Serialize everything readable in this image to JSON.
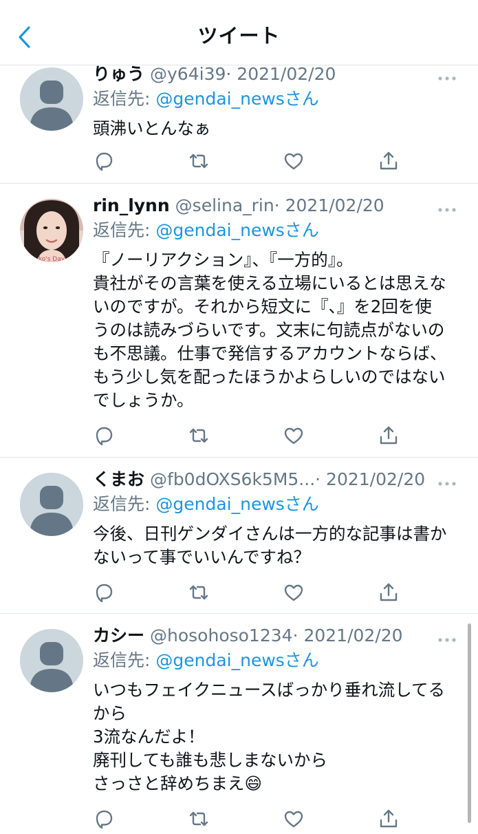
{
  "header": {
    "title": "ツイート"
  },
  "tweets": [
    {
      "name": "りゅう",
      "handle": "@y64i39",
      "date": "· 2021/02/20",
      "reply_prefix": "返信先: ",
      "reply_to": "@gendai_newsさん",
      "lines": [
        "頭沸いとんなぁ"
      ]
    },
    {
      "name": "rin_lynn",
      "handle": "@selina_rin",
      "date": "· 2021/02/20",
      "reply_prefix": "返信先: ",
      "reply_to": "@gendai_newsさん",
      "avatar_badge": "ko's Day",
      "lines": [
        "『ノーリアクション』、『一方的』。",
        "貴社がその言葉を使える立場にいるとは思えな",
        "いのですが。それから短文に『、』を2回を使",
        "うのは読みづらいです。文末に句読点がないの",
        "も不思議。仕事で発信するアカウントならば、",
        "もう少し気を配ったほうかよらしいのではない",
        "でしょうか。"
      ]
    },
    {
      "name": "くまお",
      "handle": "@fb0dOXS6k5M5...",
      "date": "· 2021/02/20",
      "reply_prefix": "返信先: ",
      "reply_to": "@gendai_newsさん",
      "lines": [
        "今後、日刊ゲンダイさんは一方的な記事は書か",
        "ないって事でいいんですね？"
      ]
    },
    {
      "name": "カシー",
      "handle": "@hosohoso1234",
      "date": "· 2021/02/20",
      "reply_prefix": "返信先: ",
      "reply_to": "@gendai_newsさん",
      "lines": [
        "いつもフェイクニュースばっかり垂れ流してる",
        "から",
        "3流なんだよ！",
        "廃刊しても誰も悲しまないから",
        "さっさと辞めちまえ😄"
      ]
    }
  ],
  "colors": {
    "link": "#1b95e0",
    "secondary_text": "#657786",
    "icon_gray": "#657786",
    "avatar_bg": "#ccd6dd",
    "avatar_fg": "#657786"
  },
  "icons": {
    "back": "chevron-left-icon",
    "more": "more-horizontal-icon",
    "reply": "reply-icon",
    "retweet": "retweet-icon",
    "like": "heart-icon",
    "share": "share-icon"
  }
}
